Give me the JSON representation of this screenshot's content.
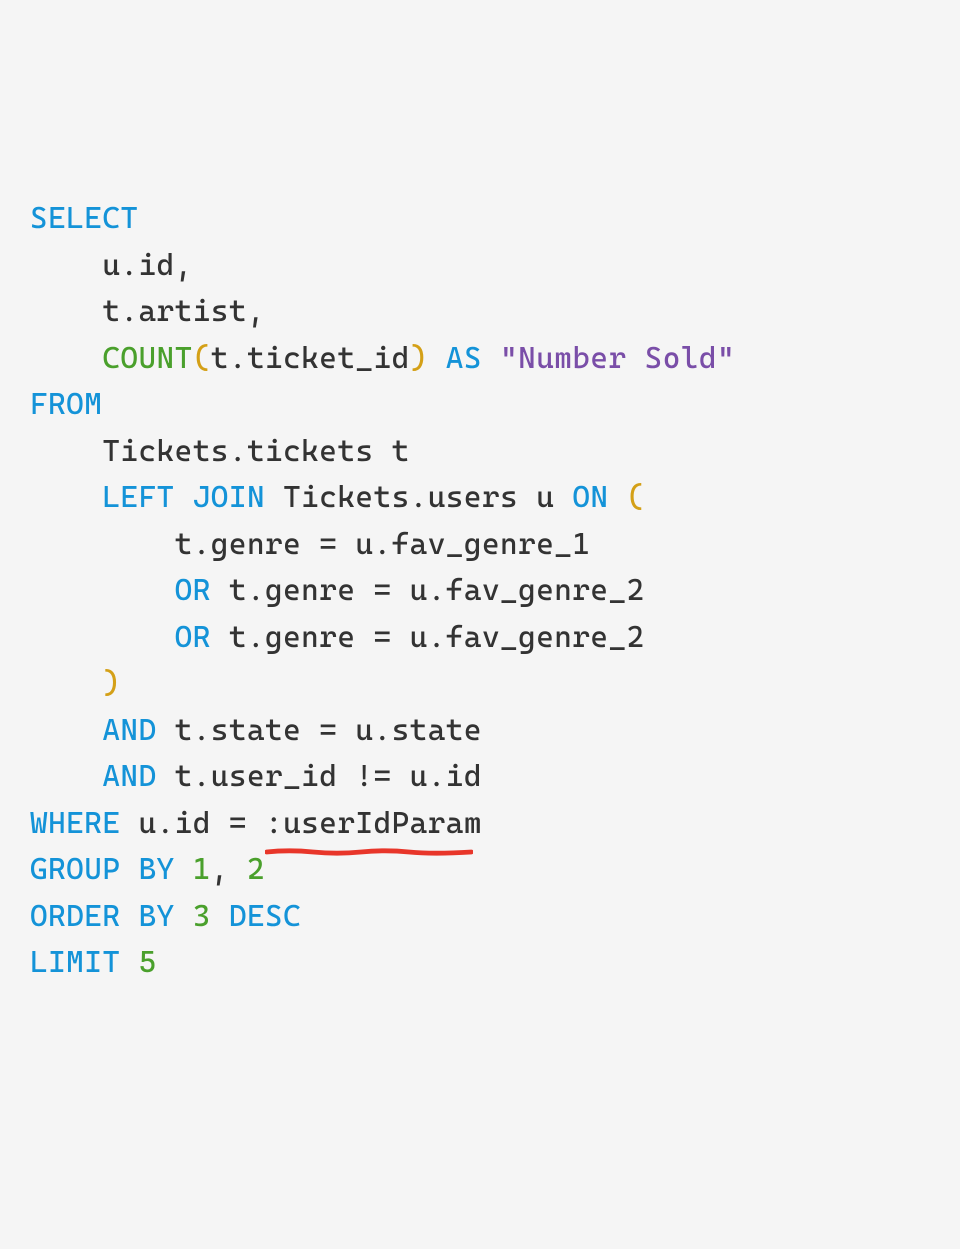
{
  "code": {
    "select": "SELECT",
    "uid": "u.id,",
    "tartist": "t.artist,",
    "count": "COUNT",
    "lp": "(",
    "tticket": "t.ticket_id",
    "rp": ")",
    "as": "AS",
    "numsold": "\"Number Sold\"",
    "from": "FROM",
    "tickets": "Tickets.tickets t",
    "leftjoin": "LEFT JOIN",
    "users": "Tickets.users u",
    "on": "ON",
    "cond1": "t.genre = u.fav_genre_1",
    "or": "OR",
    "cond2": "t.genre = u.fav_genre_2",
    "cond3": "t.genre = u.fav_genre_2",
    "and": "AND",
    "cond4": "t.state = u.state",
    "cond5": "t.user_id != u.id",
    "where": "WHERE",
    "whereleft": "u.id =",
    "param": ":userIdParam",
    "groupby": "GROUP BY",
    "g1": "1",
    "comma": ",",
    "g2": "2",
    "orderby": "ORDER BY",
    "o3": "3",
    "desc": "DESC",
    "limit": "LIMIT",
    "l5": "5"
  }
}
